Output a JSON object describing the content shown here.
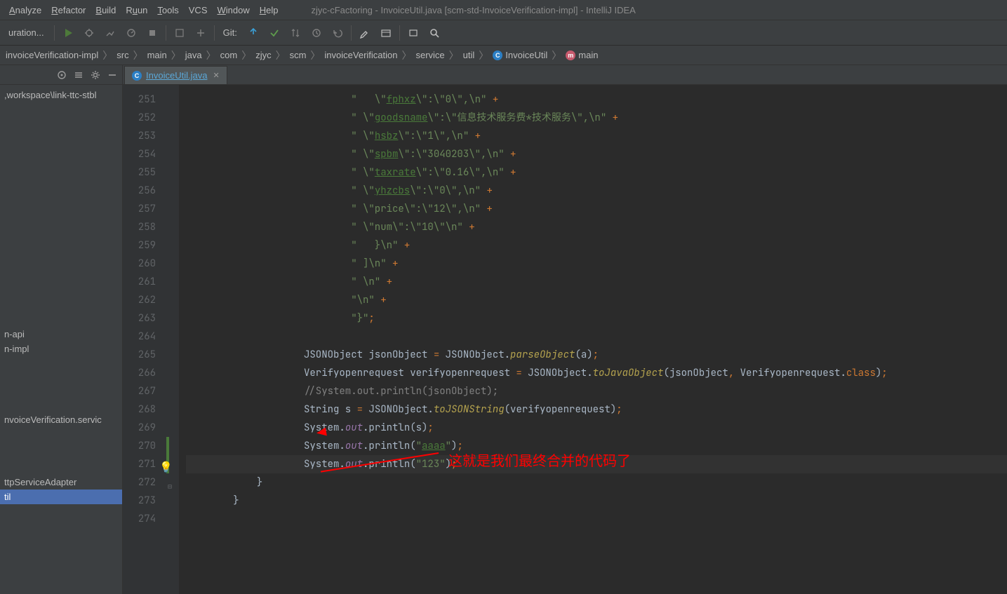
{
  "window": {
    "title": "zjyc-cFactoring - InvoiceUtil.java [scm-std-InvoiceVerification-impl] - IntelliJ IDEA"
  },
  "menu": {
    "analyze": "nalyze",
    "refactor": "efactor",
    "build": "uild",
    "run": "un",
    "tools": "ools",
    "vcs": "S",
    "window": "indow",
    "help": "elp"
  },
  "toolbar": {
    "config": "uration...",
    "git": "Git:"
  },
  "breadcrumb": [
    "invoiceVerification-impl",
    "src",
    "main",
    "java",
    "com",
    "zjyc",
    "scm",
    "invoiceVerification",
    "service",
    "util",
    "InvoiceUtil",
    "main"
  ],
  "sidebar": {
    "path": ",workspace\\link-ttc-stbl",
    "items": [
      "n-api",
      "n-impl",
      "nvoiceVerification.servic",
      "ttpServiceAdapter",
      "til"
    ],
    "selectedIndex": 4
  },
  "tab": {
    "label": "InvoiceUtil.java"
  },
  "annotation": "这就是我们最终合并的代码了",
  "code": {
    "startLine": 251,
    "lines": [
      {
        "n": 251,
        "html": "                            <span class='str'>\" &nbsp;&nbsp;\\\"</span><span class='key'>fphxz</span><span class='str'>\\\":\\\"0\\\",\\n\"</span> <span class='op'>+</span>"
      },
      {
        "n": 252,
        "html": "                            <span class='str'>\" \\\"</span><span class='key'>goodsname</span><span class='str'>\\\":\\\"信息技术服务费*技术服务\\\",\\n\"</span> <span class='op'>+</span>"
      },
      {
        "n": 253,
        "html": "                            <span class='str'>\" \\\"</span><span class='key'>hsbz</span><span class='str'>\\\":\\\"1\\\",\\n\"</span> <span class='op'>+</span>"
      },
      {
        "n": 254,
        "html": "                            <span class='str'>\" \\\"</span><span class='key'>spbm</span><span class='str'>\\\":\\\"3040203\\\",\\n\"</span> <span class='op'>+</span>"
      },
      {
        "n": 255,
        "html": "                            <span class='str'>\" \\\"</span><span class='key'>taxrate</span><span class='str'>\\\":\\\"0.16\\\",\\n\"</span> <span class='op'>+</span>"
      },
      {
        "n": 256,
        "html": "                            <span class='str'>\" \\\"</span><span class='key'>yhzcbs</span><span class='str'>\\\":\\\"0\\\",\\n\"</span> <span class='op'>+</span>"
      },
      {
        "n": 257,
        "html": "                            <span class='str'>\" \\\"price\\\":\\\"12\\\",\\n\"</span> <span class='op'>+</span>"
      },
      {
        "n": 258,
        "html": "                            <span class='str'>\" \\\"num\\\":\\\"10\\\"\\n\"</span> <span class='op'>+</span>"
      },
      {
        "n": 259,
        "html": "                            <span class='str'>\" &nbsp;&nbsp;}\\n\"</span> <span class='op'>+</span>"
      },
      {
        "n": 260,
        "html": "                            <span class='str'>\" ]\\n\"</span> <span class='op'>+</span>"
      },
      {
        "n": 261,
        "html": "                            <span class='str'>\" \\n\"</span> <span class='op'>+</span>"
      },
      {
        "n": 262,
        "html": "                            <span class='str'>\"\\n\"</span> <span class='op'>+</span>"
      },
      {
        "n": 263,
        "html": "                            <span class='str'>\"}\"</span><span class='op'>;</span>"
      },
      {
        "n": 264,
        "html": ""
      },
      {
        "n": 265,
        "html": "                    <span class='cls'>JSONObject jsonObject </span><span class='op'>=</span><span class='cls'> JSONObject.</span><span class='mtd'>parseObject</span><span class='cls'>(a)</span><span class='op'>;</span>"
      },
      {
        "n": 266,
        "html": "                    <span class='cls'>Verifyopenrequest verifyopenrequest </span><span class='op'>=</span><span class='cls'> JSONObject.</span><span class='mtd'>toJavaObject</span><span class='cls'>(jsonObject</span><span class='op'>,</span><span class='cls'> Verifyopenrequest.</span><span class='kw'>class</span><span class='cls'>)</span><span class='op'>;</span>"
      },
      {
        "n": 267,
        "html": "                    <span class='cmt'>//System.out.println(jsonObject);</span>"
      },
      {
        "n": 268,
        "html": "                    <span class='cls'>String s </span><span class='op'>=</span><span class='cls'> JSONObject.</span><span class='mtd'>toJSONString</span><span class='cls'>(verifyopenrequest)</span><span class='op'>;</span>"
      },
      {
        "n": 269,
        "html": "                    <span class='cls'>System.</span><span class='fld'>out</span><span class='cls'>.println(s)</span><span class='op'>;</span>"
      },
      {
        "n": 270,
        "html": "                    <span class='cls'>System.</span><span class='fld'>out</span><span class='cls'>.println(</span><span class='str'>\"</span><span class='key'>aaaa</span><span class='str'>\"</span><span class='cls'>)</span><span class='op'>;</span>",
        "vcs": true
      },
      {
        "n": 271,
        "html": "                    <span class='cls'>System.</span><span class='fld'>out</span><span class='cls'>.println(</span><span class='str'>\"123\"</span><span class='cls'>)</span><span class='op'>;</span>",
        "hl": true,
        "vcs": true
      },
      {
        "n": 272,
        "html": "            <span class='cls'>}</span>",
        "fold": true
      },
      {
        "n": 273,
        "html": "        <span class='cls'>}</span>"
      },
      {
        "n": 274,
        "html": ""
      }
    ]
  }
}
